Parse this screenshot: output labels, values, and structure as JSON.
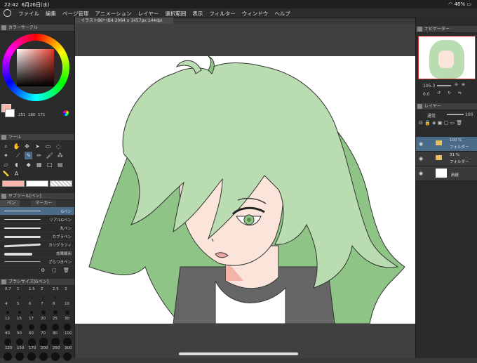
{
  "status": {
    "time": "22:42",
    "date": "6月26日(水)",
    "battery": "46%"
  },
  "menu": [
    "ファイル",
    "編集",
    "ページ管理",
    "アニメーション",
    "レイヤー",
    "選択範囲",
    "表示",
    "フィルター",
    "ウィンドウ",
    "ヘルプ"
  ],
  "document_tab": "イラスト86* (B4 2064 x 1457px 144dpi 105.3%)",
  "left": {
    "color_circle_title": "カラーサークル",
    "color_values": [
      "251",
      "180",
      "171"
    ],
    "tool_title": "ツール",
    "subtool_title": "サブツール[ペン]",
    "subtool_tabs": [
      "ペン",
      "マーカー"
    ],
    "brushes": [
      "Gペン",
      "リアルGペン",
      "丸ペン",
      "カブラペン",
      "カリグラフィ",
      "効果線用",
      "ざらつきペン"
    ],
    "brush_size_title": "ブラシサイズ[Gペン]",
    "brush_sizes": [
      "0.7",
      "1",
      "1.5",
      "2",
      "2.5",
      "3",
      "4",
      "5",
      "6",
      "7",
      "8",
      "10",
      "12",
      "15",
      "17",
      "20",
      "25",
      "30",
      "40",
      "50",
      "60",
      "70",
      "80",
      "100",
      "120",
      "150",
      "170",
      "200",
      "250",
      "300"
    ]
  },
  "right": {
    "navigator_title": "ナビゲーター",
    "zoom": "105.3",
    "rotation": "0.0",
    "layer_title": "レイヤー",
    "blend_mode": "通常",
    "opacity": "100",
    "layers": [
      {
        "opacity": "100 %",
        "type": "フォルダー",
        "name": "通常"
      },
      {
        "opacity": "31 %",
        "type": "フォルダー",
        "name": "通常"
      },
      {
        "opacity": "",
        "type": "",
        "name": "用紙"
      }
    ]
  },
  "colors": {
    "hair": "#b9dcb0",
    "hair_dark": "#8ec486",
    "skin": "#fbe4d9",
    "main_color": "#fbb4ab"
  }
}
